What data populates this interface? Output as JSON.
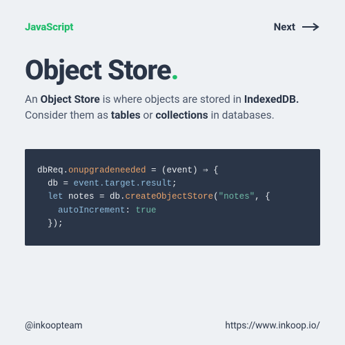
{
  "top": {
    "language": "JavaScript",
    "next_label": "Next"
  },
  "heading": {
    "text": "Object Store",
    "dot": "."
  },
  "desc": {
    "p1a": "An ",
    "p1b": "Object Store",
    "p1c": " is where objects are stored in ",
    "p1d": "IndexedDB.",
    "p1e": " Consider them as ",
    "p1f": "tables",
    "p1g": " or ",
    "p1h": "collections",
    "p1i": " in databases."
  },
  "code": {
    "l1a": "dbReq.",
    "l1b": "onupgradeneeded",
    "l1c": " = (event) ⇒ {",
    "l2a": "  db = ",
    "l2b": "event.target.result",
    "l2c": ";",
    "l3a": "  let",
    "l3b": " notes = db.",
    "l3c": "createObjectStore",
    "l3d": "(",
    "l3e": "\"notes\"",
    "l3f": ", {",
    "l4a": "    autoIncrement",
    "l4b": ": ",
    "l4c": "true",
    "l5a": "  });"
  },
  "footer": {
    "handle": "@inkoopteam",
    "url": "https://www.inkoop.io/"
  }
}
